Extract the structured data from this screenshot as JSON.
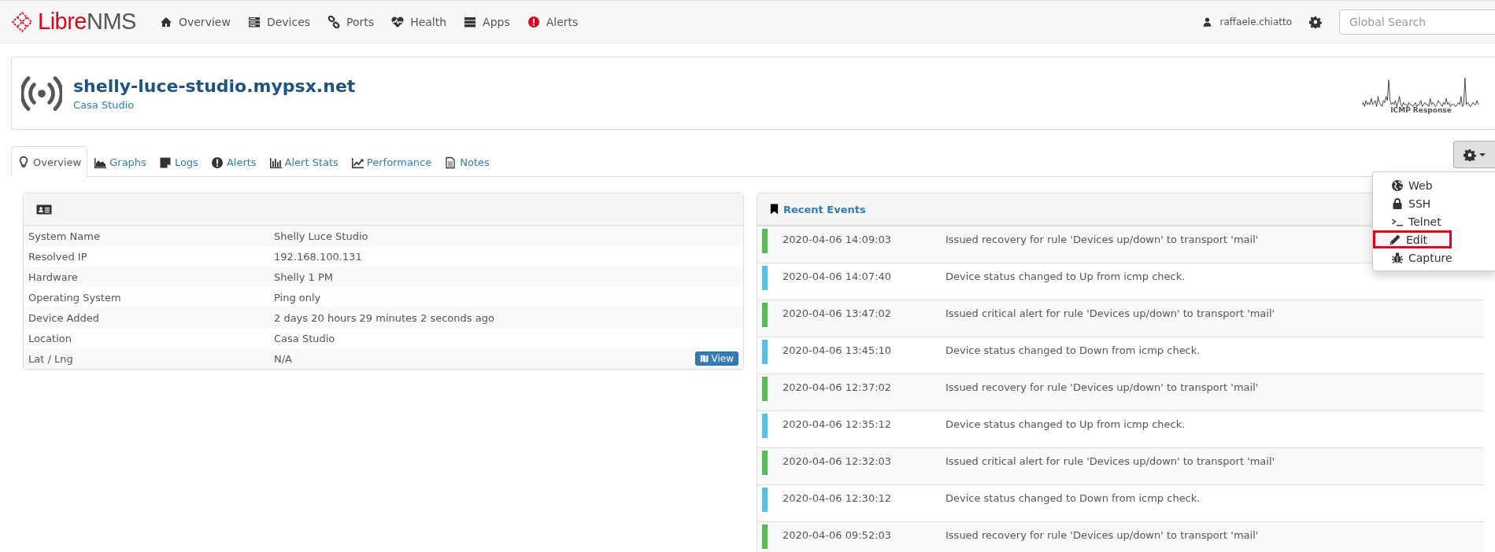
{
  "navbar": {
    "logo": {
      "primary": "Libre",
      "secondary": "NMS"
    },
    "items": [
      {
        "label": "Overview"
      },
      {
        "label": "Devices"
      },
      {
        "label": "Ports"
      },
      {
        "label": "Health"
      },
      {
        "label": "Apps"
      },
      {
        "label": "Alerts"
      }
    ],
    "user": "raffaele.chiatto",
    "search": {
      "placeholder": "Global Search"
    }
  },
  "device": {
    "hostname": "shelly-luce-studio.mypsx.net",
    "location": "Casa Studio",
    "graph_label": "ICMP Response"
  },
  "tabs": [
    {
      "label": "Overview",
      "selected": true
    },
    {
      "label": "Graphs",
      "selected": false
    },
    {
      "label": "Logs",
      "selected": false
    },
    {
      "label": "Alerts",
      "selected": false
    },
    {
      "label": "Alert Stats",
      "selected": false
    },
    {
      "label": "Performance",
      "selected": false
    },
    {
      "label": "Notes",
      "selected": false
    }
  ],
  "actions_menu": {
    "open": true,
    "items": [
      {
        "label": "Web",
        "highlighted": false
      },
      {
        "label": "SSH",
        "highlighted": false
      },
      {
        "label": "Telnet",
        "highlighted": false
      },
      {
        "label": "Edit",
        "highlighted": true
      },
      {
        "label": "Capture",
        "highlighted": false
      }
    ]
  },
  "overview": {
    "rows": [
      {
        "label": "System Name",
        "value": "Shelly Luce Studio"
      },
      {
        "label": "Resolved IP",
        "value": "192.168.100.131"
      },
      {
        "label": "Hardware",
        "value": "Shelly 1 PM"
      },
      {
        "label": "Operating System",
        "value": "Ping only"
      },
      {
        "label": "Device Added",
        "value": "2 days 20 hours 29 minutes 2 seconds ago"
      },
      {
        "label": "Location",
        "value": "Casa Studio"
      },
      {
        "label": "Lat / Lng",
        "value": "N/A",
        "button": "View"
      }
    ]
  },
  "recent_events": {
    "title": "Recent Events",
    "rows": [
      {
        "time": "2020-04-06 14:09:03",
        "message": "Issued recovery for rule 'Devices up/down' to transport 'mail'",
        "color": "#5cb85c"
      },
      {
        "time": "2020-04-06 14:07:40",
        "message": "Device status changed to Up from icmp check.",
        "color": "#5bc0de"
      },
      {
        "time": "2020-04-06 13:47:02",
        "message": "Issued critical alert for rule 'Devices up/down' to transport 'mail'",
        "color": "#5cb85c"
      },
      {
        "time": "2020-04-06 13:45:10",
        "message": "Device status changed to Down from icmp check.",
        "color": "#5bc0de"
      },
      {
        "time": "2020-04-06 12:37:02",
        "message": "Issued recovery for rule 'Devices up/down' to transport 'mail'",
        "color": "#5cb85c"
      },
      {
        "time": "2020-04-06 12:35:12",
        "message": "Device status changed to Up from icmp check.",
        "color": "#5bc0de"
      },
      {
        "time": "2020-04-06 12:32:03",
        "message": "Issued critical alert for rule 'Devices up/down' to transport 'mail'",
        "color": "#5cb85c"
      },
      {
        "time": "2020-04-06 12:30:12",
        "message": "Device status changed to Down from icmp check.",
        "color": "#5bc0de"
      },
      {
        "time": "2020-04-06 09:52:03",
        "message": "Issued recovery for rule 'Devices up/down' to transport 'mail'",
        "color": "#5cb85c"
      }
    ]
  }
}
